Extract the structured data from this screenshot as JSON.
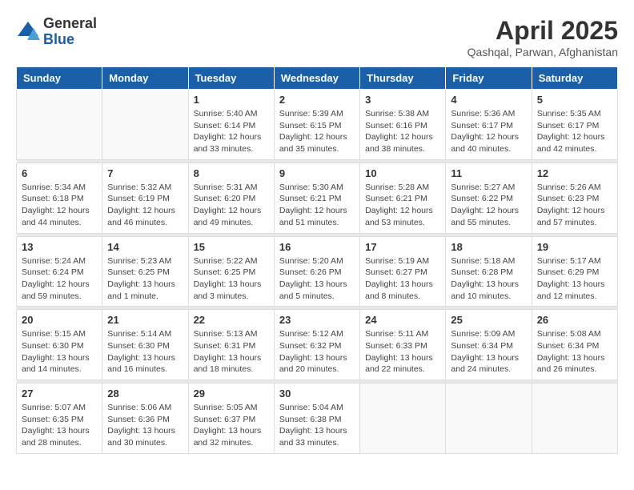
{
  "logo": {
    "general": "General",
    "blue": "Blue"
  },
  "title": "April 2025",
  "location": "Qashqal, Parwan, Afghanistan",
  "weekdays": [
    "Sunday",
    "Monday",
    "Tuesday",
    "Wednesday",
    "Thursday",
    "Friday",
    "Saturday"
  ],
  "weeks": [
    [
      {
        "day": "",
        "info": ""
      },
      {
        "day": "",
        "info": ""
      },
      {
        "day": "1",
        "info": "Sunrise: 5:40 AM\nSunset: 6:14 PM\nDaylight: 12 hours\nand 33 minutes."
      },
      {
        "day": "2",
        "info": "Sunrise: 5:39 AM\nSunset: 6:15 PM\nDaylight: 12 hours\nand 35 minutes."
      },
      {
        "day": "3",
        "info": "Sunrise: 5:38 AM\nSunset: 6:16 PM\nDaylight: 12 hours\nand 38 minutes."
      },
      {
        "day": "4",
        "info": "Sunrise: 5:36 AM\nSunset: 6:17 PM\nDaylight: 12 hours\nand 40 minutes."
      },
      {
        "day": "5",
        "info": "Sunrise: 5:35 AM\nSunset: 6:17 PM\nDaylight: 12 hours\nand 42 minutes."
      }
    ],
    [
      {
        "day": "6",
        "info": "Sunrise: 5:34 AM\nSunset: 6:18 PM\nDaylight: 12 hours\nand 44 minutes."
      },
      {
        "day": "7",
        "info": "Sunrise: 5:32 AM\nSunset: 6:19 PM\nDaylight: 12 hours\nand 46 minutes."
      },
      {
        "day": "8",
        "info": "Sunrise: 5:31 AM\nSunset: 6:20 PM\nDaylight: 12 hours\nand 49 minutes."
      },
      {
        "day": "9",
        "info": "Sunrise: 5:30 AM\nSunset: 6:21 PM\nDaylight: 12 hours\nand 51 minutes."
      },
      {
        "day": "10",
        "info": "Sunrise: 5:28 AM\nSunset: 6:21 PM\nDaylight: 12 hours\nand 53 minutes."
      },
      {
        "day": "11",
        "info": "Sunrise: 5:27 AM\nSunset: 6:22 PM\nDaylight: 12 hours\nand 55 minutes."
      },
      {
        "day": "12",
        "info": "Sunrise: 5:26 AM\nSunset: 6:23 PM\nDaylight: 12 hours\nand 57 minutes."
      }
    ],
    [
      {
        "day": "13",
        "info": "Sunrise: 5:24 AM\nSunset: 6:24 PM\nDaylight: 12 hours\nand 59 minutes."
      },
      {
        "day": "14",
        "info": "Sunrise: 5:23 AM\nSunset: 6:25 PM\nDaylight: 13 hours\nand 1 minute."
      },
      {
        "day": "15",
        "info": "Sunrise: 5:22 AM\nSunset: 6:25 PM\nDaylight: 13 hours\nand 3 minutes."
      },
      {
        "day": "16",
        "info": "Sunrise: 5:20 AM\nSunset: 6:26 PM\nDaylight: 13 hours\nand 5 minutes."
      },
      {
        "day": "17",
        "info": "Sunrise: 5:19 AM\nSunset: 6:27 PM\nDaylight: 13 hours\nand 8 minutes."
      },
      {
        "day": "18",
        "info": "Sunrise: 5:18 AM\nSunset: 6:28 PM\nDaylight: 13 hours\nand 10 minutes."
      },
      {
        "day": "19",
        "info": "Sunrise: 5:17 AM\nSunset: 6:29 PM\nDaylight: 13 hours\nand 12 minutes."
      }
    ],
    [
      {
        "day": "20",
        "info": "Sunrise: 5:15 AM\nSunset: 6:30 PM\nDaylight: 13 hours\nand 14 minutes."
      },
      {
        "day": "21",
        "info": "Sunrise: 5:14 AM\nSunset: 6:30 PM\nDaylight: 13 hours\nand 16 minutes."
      },
      {
        "day": "22",
        "info": "Sunrise: 5:13 AM\nSunset: 6:31 PM\nDaylight: 13 hours\nand 18 minutes."
      },
      {
        "day": "23",
        "info": "Sunrise: 5:12 AM\nSunset: 6:32 PM\nDaylight: 13 hours\nand 20 minutes."
      },
      {
        "day": "24",
        "info": "Sunrise: 5:11 AM\nSunset: 6:33 PM\nDaylight: 13 hours\nand 22 minutes."
      },
      {
        "day": "25",
        "info": "Sunrise: 5:09 AM\nSunset: 6:34 PM\nDaylight: 13 hours\nand 24 minutes."
      },
      {
        "day": "26",
        "info": "Sunrise: 5:08 AM\nSunset: 6:34 PM\nDaylight: 13 hours\nand 26 minutes."
      }
    ],
    [
      {
        "day": "27",
        "info": "Sunrise: 5:07 AM\nSunset: 6:35 PM\nDaylight: 13 hours\nand 28 minutes."
      },
      {
        "day": "28",
        "info": "Sunrise: 5:06 AM\nSunset: 6:36 PM\nDaylight: 13 hours\nand 30 minutes."
      },
      {
        "day": "29",
        "info": "Sunrise: 5:05 AM\nSunset: 6:37 PM\nDaylight: 13 hours\nand 32 minutes."
      },
      {
        "day": "30",
        "info": "Sunrise: 5:04 AM\nSunset: 6:38 PM\nDaylight: 13 hours\nand 33 minutes."
      },
      {
        "day": "",
        "info": ""
      },
      {
        "day": "",
        "info": ""
      },
      {
        "day": "",
        "info": ""
      }
    ]
  ]
}
